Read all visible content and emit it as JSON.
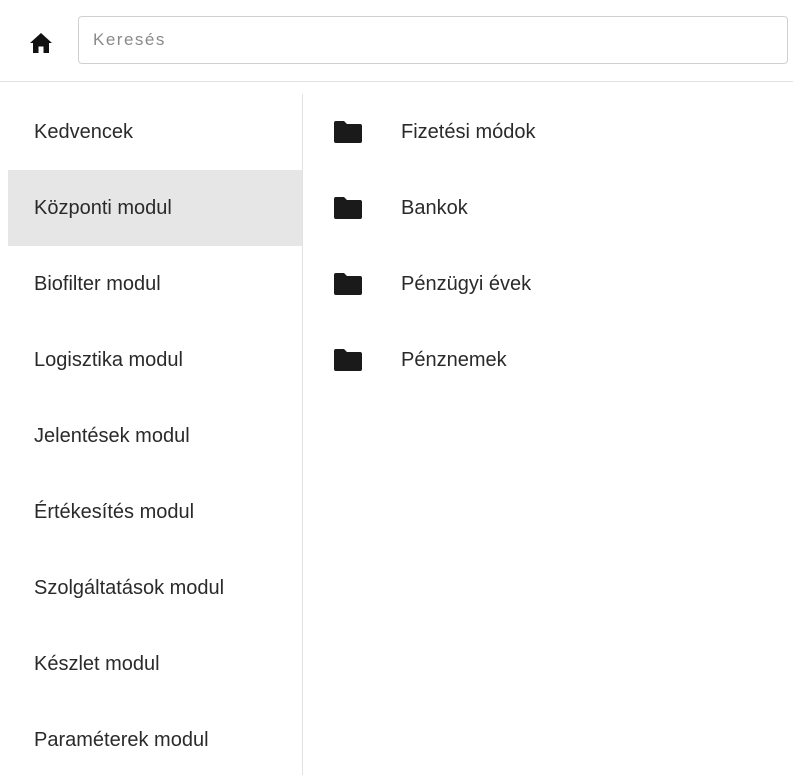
{
  "header": {
    "home_icon": "home-icon",
    "search": {
      "placeholder": "Keresés",
      "value": ""
    }
  },
  "sidebar": {
    "items": [
      {
        "label": "Kedvencek",
        "active": false
      },
      {
        "label": "Központi modul",
        "active": true
      },
      {
        "label": "Biofilter modul",
        "active": false
      },
      {
        "label": "Logisztika modul",
        "active": false
      },
      {
        "label": "Jelentések modul",
        "active": false
      },
      {
        "label": "Értékesítés modul",
        "active": false
      },
      {
        "label": "Szolgáltatások modul",
        "active": false
      },
      {
        "label": "Készlet modul",
        "active": false
      },
      {
        "label": "Paraméterek modul",
        "active": false
      }
    ],
    "active_bg": "#e6e6e6"
  },
  "content": {
    "folders": [
      {
        "label": "Fizetési módok",
        "icon": "folder-icon"
      },
      {
        "label": "Bankok",
        "icon": "folder-icon"
      },
      {
        "label": "Pénzügyi évek",
        "icon": "folder-icon"
      },
      {
        "label": "Pénznemek",
        "icon": "folder-icon"
      }
    ]
  }
}
